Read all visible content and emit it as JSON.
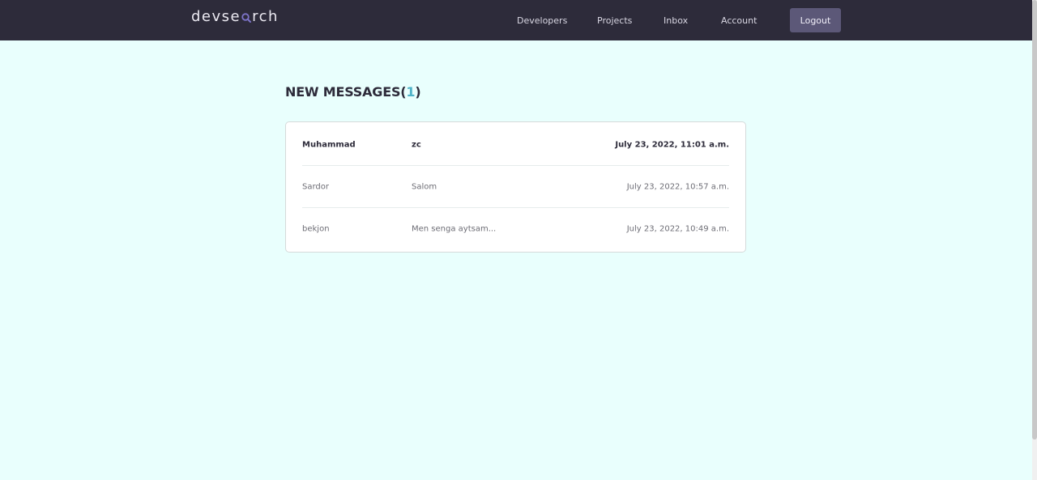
{
  "header": {
    "logo_prefix": "devse",
    "logo_suffix": "rch",
    "nav": {
      "developers": "Developers",
      "projects": "Projects",
      "inbox": "Inbox",
      "account": "Account"
    },
    "logout_label": "Logout"
  },
  "main": {
    "title_text": "NEW MESSAGES",
    "title_open": "(",
    "unread_count": "1",
    "title_close": ")",
    "messages": [
      {
        "sender": "Muhammad",
        "subject": "zc",
        "date": "July 23, 2022, 11:01 a.m.",
        "unread": true
      },
      {
        "sender": "Sardor",
        "subject": "Salom",
        "date": "July 23, 2022, 10:57 a.m.",
        "unread": false
      },
      {
        "sender": "bekjon",
        "subject": "Men senga aytsam...",
        "date": "July 23, 2022, 10:49 a.m.",
        "unread": false
      }
    ]
  },
  "icons": {
    "logo_magnifier": "magnifier-icon"
  },
  "colors": {
    "header_bg": "#2d2b3a",
    "page_bg": "#e9fffd",
    "accent": "#4fb3c8",
    "logout_bg": "#5c5878"
  }
}
